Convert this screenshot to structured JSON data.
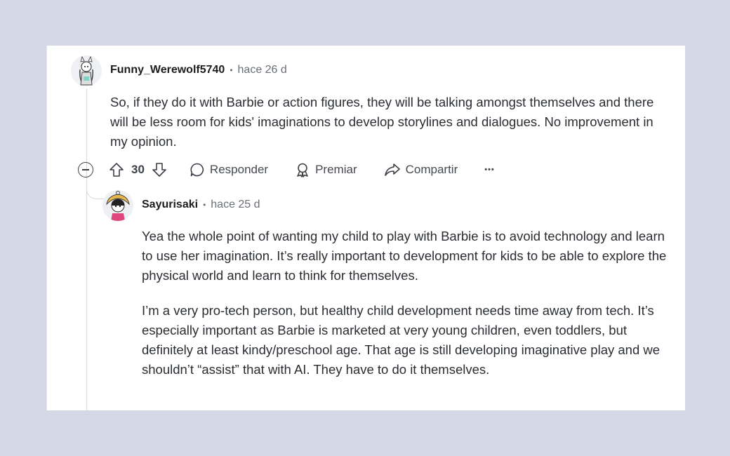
{
  "comment1": {
    "author": "Funny_Werewolf5740",
    "time": "hace 26 d",
    "body": "So, if they do it with Barbie or action figures, they will be talking amongst themselves and there will be less room for kids' imaginations to develop storylines and dialogues. No improvement in my opinion.",
    "votes": "30",
    "reply_label": "Responder",
    "award_label": "Premiar",
    "share_label": "Compartir",
    "more_label": "•••"
  },
  "comment2": {
    "author": "Sayurisaki",
    "time": "hace 25 d",
    "paragraph1": "Yea the whole point of wanting my child to play with Barbie is to avoid technology and learn to use her imagination. It’s really important to development for kids to be able to explore the physical world and learn to think for themselves.",
    "paragraph2": "I’m a very pro-tech person, but healthy child development needs time away from tech. It’s especially important as Barbie is marketed at very young children, even toddlers, but definitely at least kindy/preschool age. That age is still developing imaginative play and we shouldn’t “assist” that with AI. They have to do it themselves."
  },
  "colors": {
    "page_background": "#d4d8e6",
    "card_background": "#ffffff",
    "meta_gray": "#6a6f76"
  }
}
